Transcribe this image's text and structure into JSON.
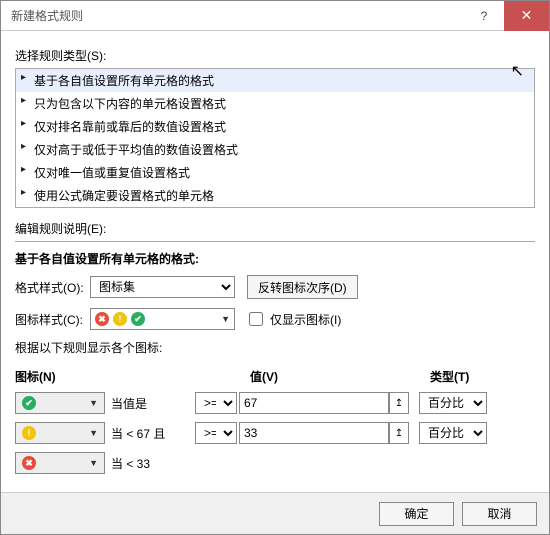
{
  "title": "新建格式规则",
  "section_rule_type": "选择规则类型(S):",
  "rule_types": [
    "基于各自值设置所有单元格的格式",
    "只为包含以下内容的单元格设置格式",
    "仅对排名靠前或靠后的数值设置格式",
    "仅对高于或低于平均值的数值设置格式",
    "仅对唯一值或重复值设置格式",
    "使用公式确定要设置格式的单元格"
  ],
  "section_edit": "编辑规则说明(E):",
  "group_title": "基于各自值设置所有单元格的格式:",
  "format_style_label": "格式样式(O):",
  "format_style_value": "图标集",
  "reverse_icon_order": "反转图标次序(D)",
  "icon_style_label": "图标样式(C):",
  "show_icon_only": "仅显示图标(I)",
  "rule_display_label": "根据以下规则显示各个图标:",
  "header_icon": "图标(N)",
  "header_value": "值(V)",
  "header_type": "类型(T)",
  "rows": [
    {
      "icon": "green",
      "cond": "当值是",
      "op": ">=",
      "val": "67",
      "type": "百分比"
    },
    {
      "icon": "yellow",
      "cond": "当 < 67 且",
      "op": ">=",
      "val": "33",
      "type": "百分比"
    },
    {
      "icon": "red",
      "cond": "当 < 33",
      "op": "",
      "val": "",
      "type": ""
    }
  ],
  "ok": "确定",
  "cancel": "取消"
}
